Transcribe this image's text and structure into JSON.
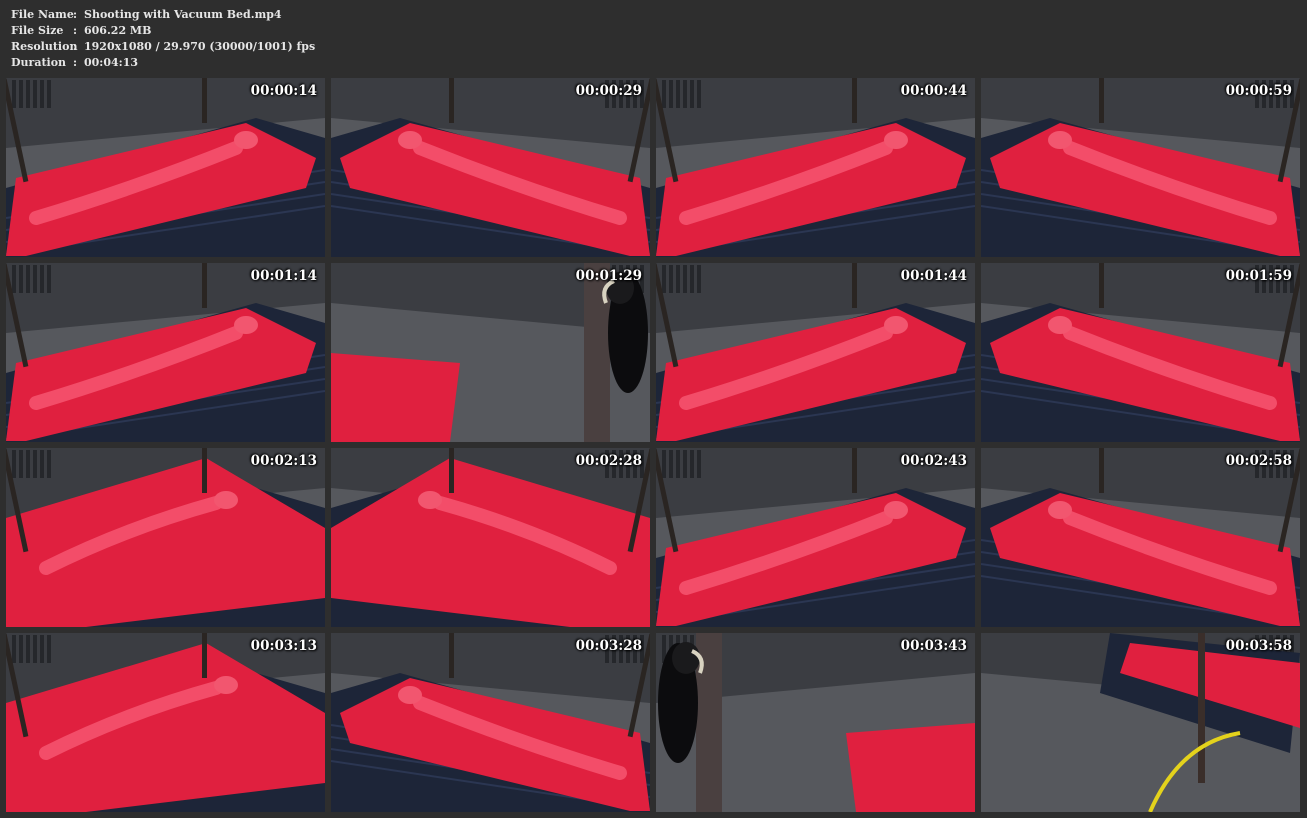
{
  "info": {
    "file_name": {
      "label": "File Name",
      "colon": ":",
      "value": "Shooting with Vacuum Bed.mp4"
    },
    "file_size": {
      "label": "File Size",
      "colon": ":",
      "value": "606.22 MB"
    },
    "resolution": {
      "label": "Resolution",
      "colon": ":",
      "value": "1920x1080 / 29.970 (30000/1001) fps"
    },
    "duration": {
      "label": "Duration",
      "colon": ":",
      "value": "00:04:13"
    }
  },
  "thumbnails": [
    {
      "time": "00:00:14",
      "scene": "bed"
    },
    {
      "time": "00:00:29",
      "scene": "bed"
    },
    {
      "time": "00:00:44",
      "scene": "bed"
    },
    {
      "time": "00:00:59",
      "scene": "bed"
    },
    {
      "time": "00:01:14",
      "scene": "bed"
    },
    {
      "time": "00:01:29",
      "scene": "figure"
    },
    {
      "time": "00:01:44",
      "scene": "bed"
    },
    {
      "time": "00:01:59",
      "scene": "bed"
    },
    {
      "time": "00:02:13",
      "scene": "closeup"
    },
    {
      "time": "00:02:28",
      "scene": "closeup"
    },
    {
      "time": "00:02:43",
      "scene": "bed"
    },
    {
      "time": "00:02:58",
      "scene": "bed"
    },
    {
      "time": "00:03:13",
      "scene": "closeup"
    },
    {
      "time": "00:03:28",
      "scene": "bed"
    },
    {
      "time": "00:03:43",
      "scene": "figure"
    },
    {
      "time": "00:03:58",
      "scene": "hose"
    }
  ],
  "colors": {
    "background": "#2e2e2e",
    "latex_red": "#e0203f",
    "mattress_navy": "#1d2538",
    "room_grey": "#3b3d42"
  }
}
